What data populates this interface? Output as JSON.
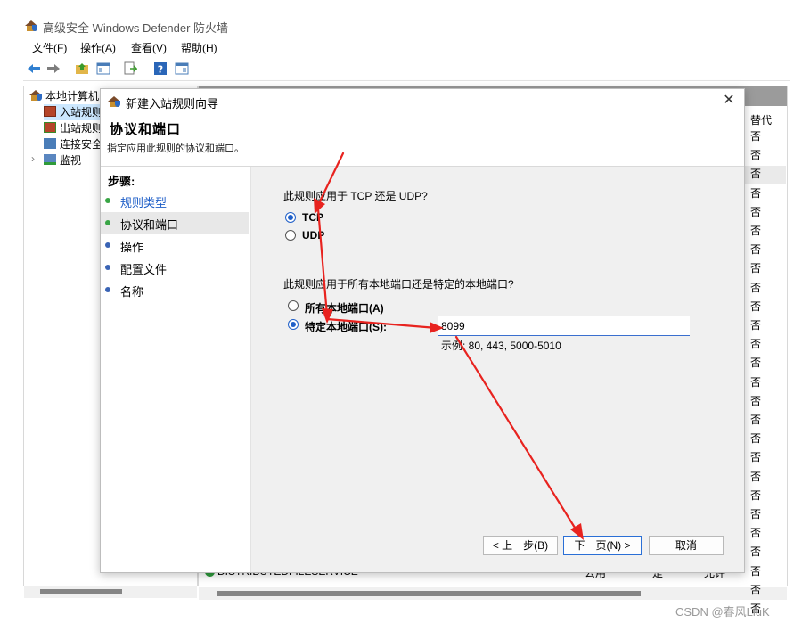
{
  "window": {
    "title": "高级安全 Windows Defender 防火墙"
  },
  "menubar": [
    "文件(F)",
    "操作(A)",
    "查看(V)",
    "帮助(H)"
  ],
  "tree": {
    "root": "本地计算机",
    "items": [
      "入站规则",
      "出站规则",
      "连接安全",
      "监视"
    ],
    "expander": "›"
  },
  "list": {
    "alt_header": "替代",
    "alt_values": [
      "否",
      "否",
      "否",
      "否",
      "否",
      "否",
      "否",
      "否",
      "否",
      "否",
      "否",
      "否",
      "否",
      "否",
      "否",
      "否",
      "否",
      "否",
      "否",
      "否",
      "否",
      "否",
      "否",
      "否",
      "否",
      "否"
    ],
    "bottom_row": {
      "name": "DISTRIBUTEDFILESERVICE",
      "profile": "公用",
      "enabled": "是",
      "action": "允许"
    }
  },
  "dialog": {
    "title": "新建入站规则向导",
    "close": "✕",
    "heading": "协议和端口",
    "subtitle": "指定应用此规则的协议和端口。",
    "steps_title": "步骤:",
    "steps": [
      {
        "label": "规则类型",
        "active": false,
        "done": true
      },
      {
        "label": "协议和端口",
        "active": true,
        "done": true
      },
      {
        "label": "操作",
        "active": false,
        "done": false
      },
      {
        "label": "配置文件",
        "active": false,
        "done": false
      },
      {
        "label": "名称",
        "active": false,
        "done": false
      }
    ],
    "q1": "此规则应用于 TCP 还是 UDP?",
    "protocol_options": [
      "TCP",
      "UDP"
    ],
    "protocol_selected": "TCP",
    "q2": "此规则应用于所有本地端口还是特定的本地端口?",
    "port_options": [
      "所有本地端口(A)",
      "特定本地端口(S):"
    ],
    "port_selected": "特定本地端口(S):",
    "port_value": "8099",
    "example": "示例: 80, 443, 5000-5010",
    "buttons": {
      "back": "< 上一步(B)",
      "next": "下一页(N) >",
      "cancel": "取消"
    }
  },
  "watermark": "CSDN @春风LiuK",
  "colors": {
    "accent": "#1f5fc8",
    "arrow": "#e8231f",
    "header": "#9b9b9b"
  }
}
